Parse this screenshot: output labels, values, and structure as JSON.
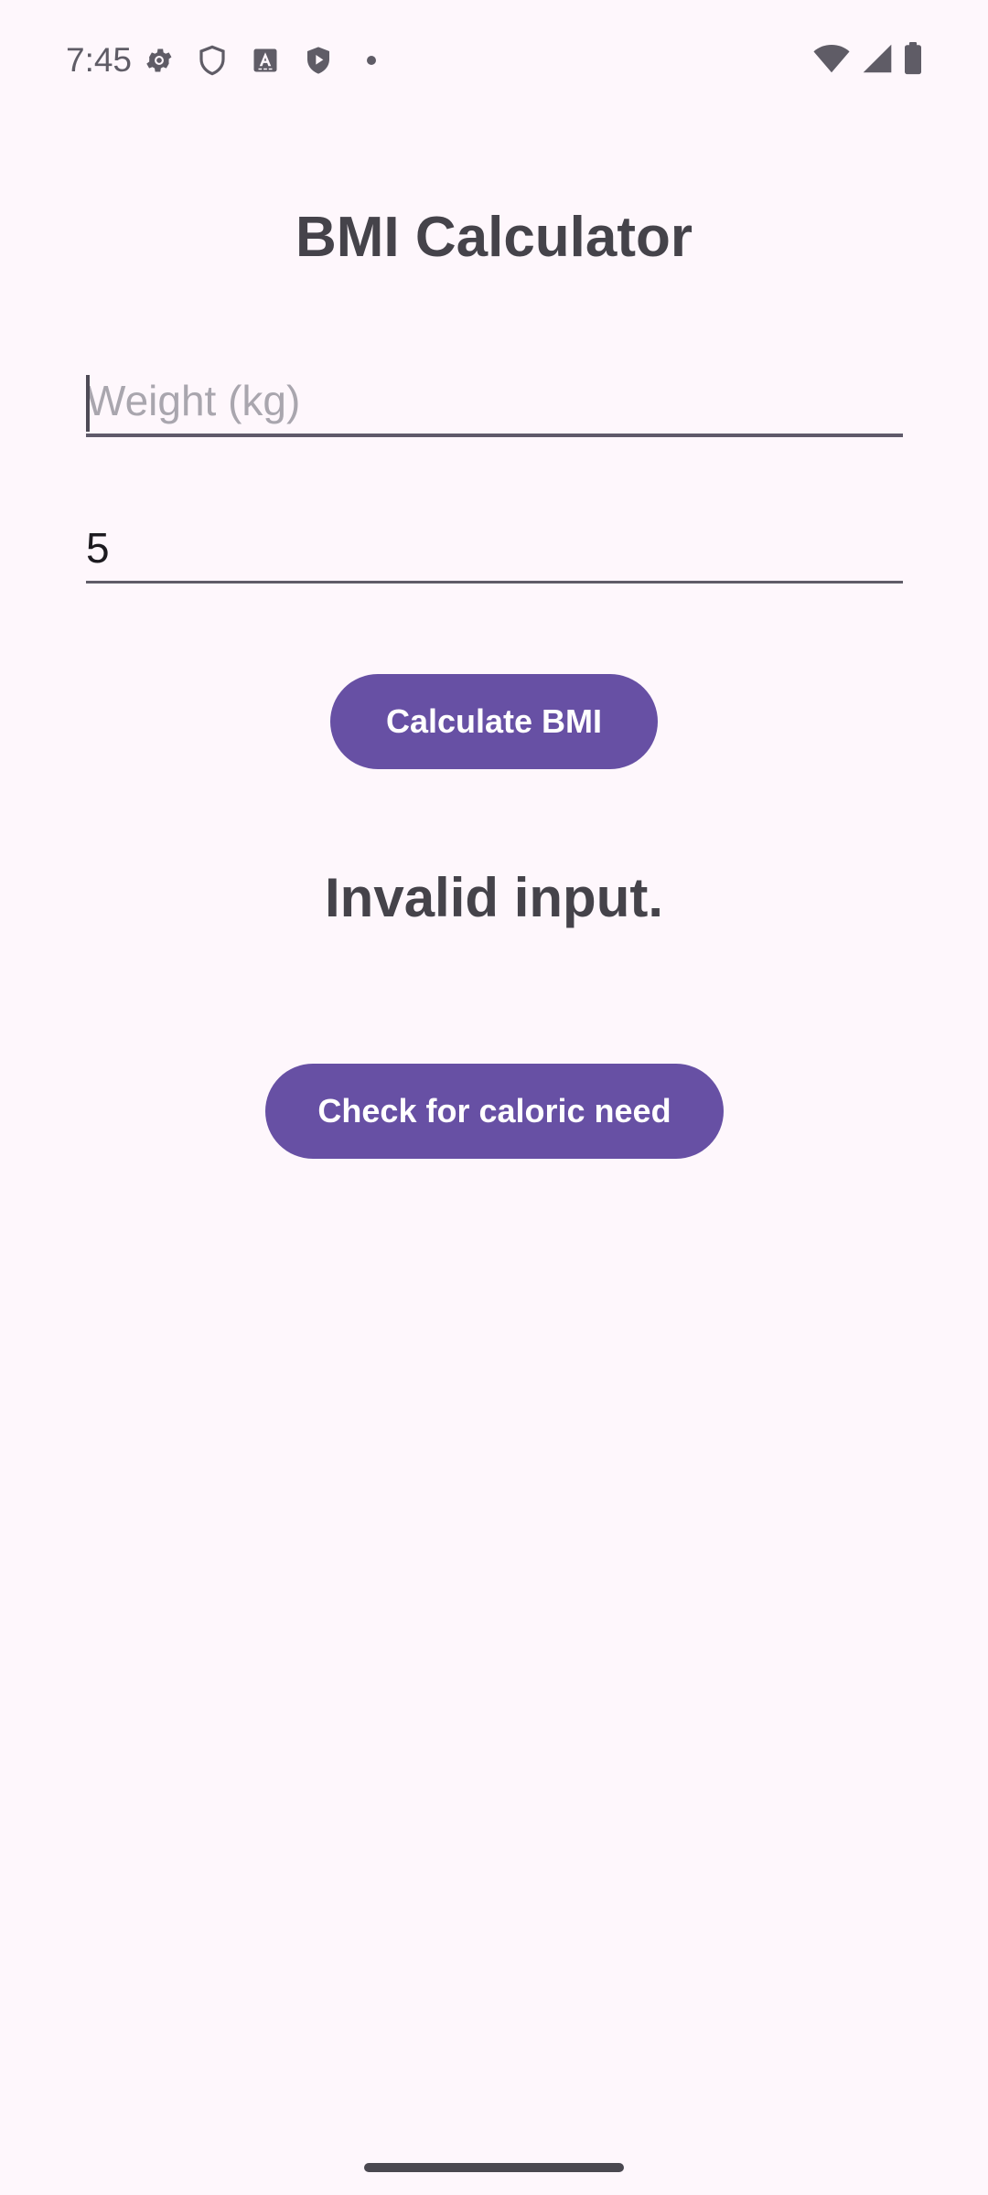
{
  "status_bar": {
    "time": "7:45",
    "left_icons": [
      "gear-icon",
      "shield-outline-icon",
      "font-a-icon",
      "shield-play-icon",
      "dot-icon"
    ],
    "right_icons": [
      "wifi-icon",
      "cellular-signal-icon",
      "battery-icon"
    ]
  },
  "app": {
    "title": "BMI Calculator"
  },
  "form": {
    "weight": {
      "placeholder": "Weight (kg)",
      "value": ""
    },
    "height": {
      "value": "5"
    },
    "calculate_label": "Calculate BMI"
  },
  "result": {
    "text": "Invalid input."
  },
  "caloric": {
    "label": "Check for caloric need"
  },
  "colors": {
    "background": "#FEF7FC",
    "primary": "#6750A4",
    "text": "#45434A"
  }
}
